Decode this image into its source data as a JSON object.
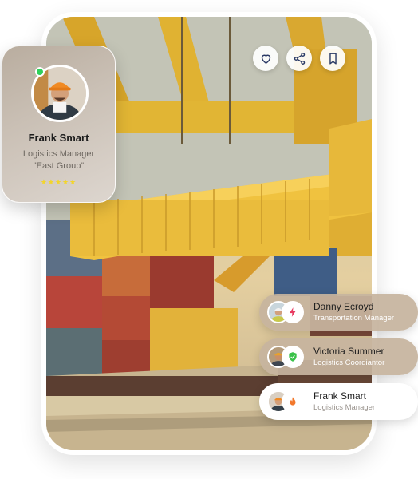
{
  "profile": {
    "name": "Frank Smart",
    "role": "Logistics Manager",
    "group": "\"East Group\"",
    "stars": "★★★★★",
    "online": true,
    "status_color": "#2fd05a",
    "star_color": "#f3d52a"
  },
  "photo": {
    "actions": [
      {
        "icon": "heart-icon"
      },
      {
        "icon": "share-icon"
      },
      {
        "icon": "bookmark-icon"
      }
    ]
  },
  "contacts": [
    {
      "name": "Danny Ecroyd",
      "role": "Transportation Manager",
      "badge_icon": "lightning-icon",
      "badge_color": "#e8385f"
    },
    {
      "name": "Victoria Summer",
      "role": "Logistics Coordiantor",
      "badge_icon": "shield-check-icon",
      "badge_color": "#3ac24a"
    },
    {
      "name": "Frank Smart",
      "role": "Logistics Manager",
      "badge_icon": "flame-icon",
      "badge_color": "#f2782c"
    }
  ]
}
